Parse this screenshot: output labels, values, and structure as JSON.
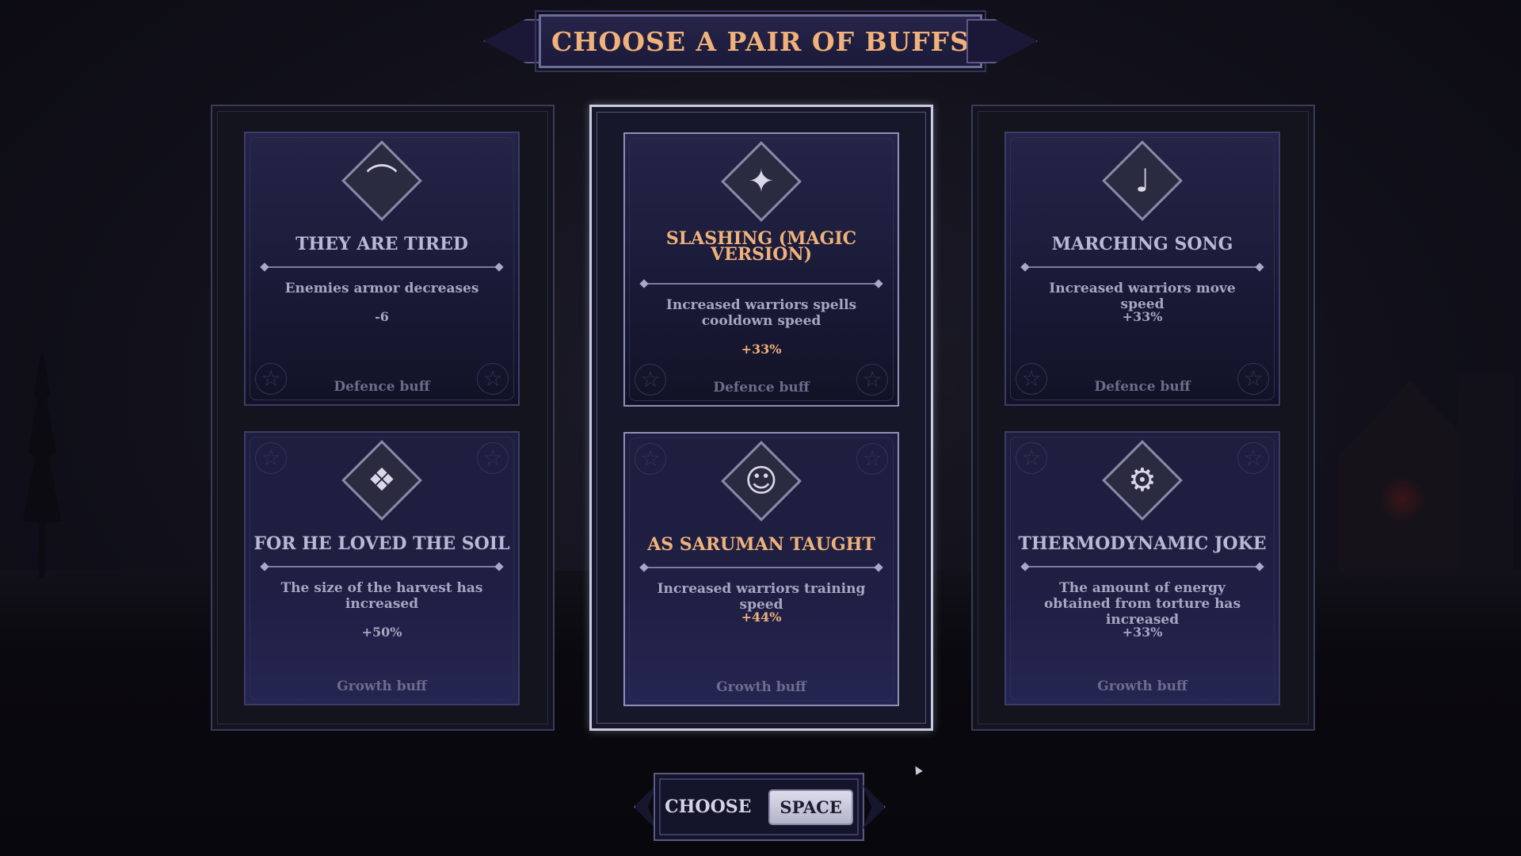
{
  "title": "CHOOSE A PAIR OF BUFFS",
  "columns": [
    {
      "selected": false,
      "cards": [
        {
          "icon": "broken-limb-icon",
          "glyph": "⌒",
          "title": "THEY ARE TIRED",
          "description": "Enemies armor decreases",
          "value": "-6",
          "category": "Defence buff"
        },
        {
          "icon": "soil-shield-icon",
          "glyph": "❖",
          "title": "FOR HE LOVED THE SOIL",
          "description": "The size of the harvest has increased",
          "value": "+50%",
          "category": "Growth buff"
        }
      ]
    },
    {
      "selected": true,
      "cards": [
        {
          "icon": "magic-staff-icon",
          "glyph": "✦",
          "title": "SLASHING (MAGIC VERSION)",
          "description": "Increased warriors spells cooldown speed",
          "value": "+33%",
          "category": "Defence buff"
        },
        {
          "icon": "wizard-portrait-icon",
          "glyph": "☺",
          "title": "AS SARUMAN TAUGHT",
          "description": "Increased warriors training speed",
          "value": "+44%",
          "category": "Growth buff"
        }
      ]
    },
    {
      "selected": false,
      "cards": [
        {
          "icon": "treble-clef-icon",
          "glyph": "♩",
          "title": "MARCHING SONG",
          "description": "Increased warriors move speed",
          "value": "+33%",
          "category": "Defence buff"
        },
        {
          "icon": "machine-icon",
          "glyph": "⚙",
          "title": "THERMODYNAMIC JOKE",
          "description": "The amount of energy obtained from torture has increased",
          "value": "+33%",
          "category": "Growth buff"
        }
      ]
    }
  ],
  "footer": {
    "choose_label": "CHOOSE",
    "key_label": "SPACE"
  },
  "colors": {
    "accent": "#f0b27a",
    "card_text": "#a7a7c2",
    "category_text": "#6c6c8c"
  }
}
